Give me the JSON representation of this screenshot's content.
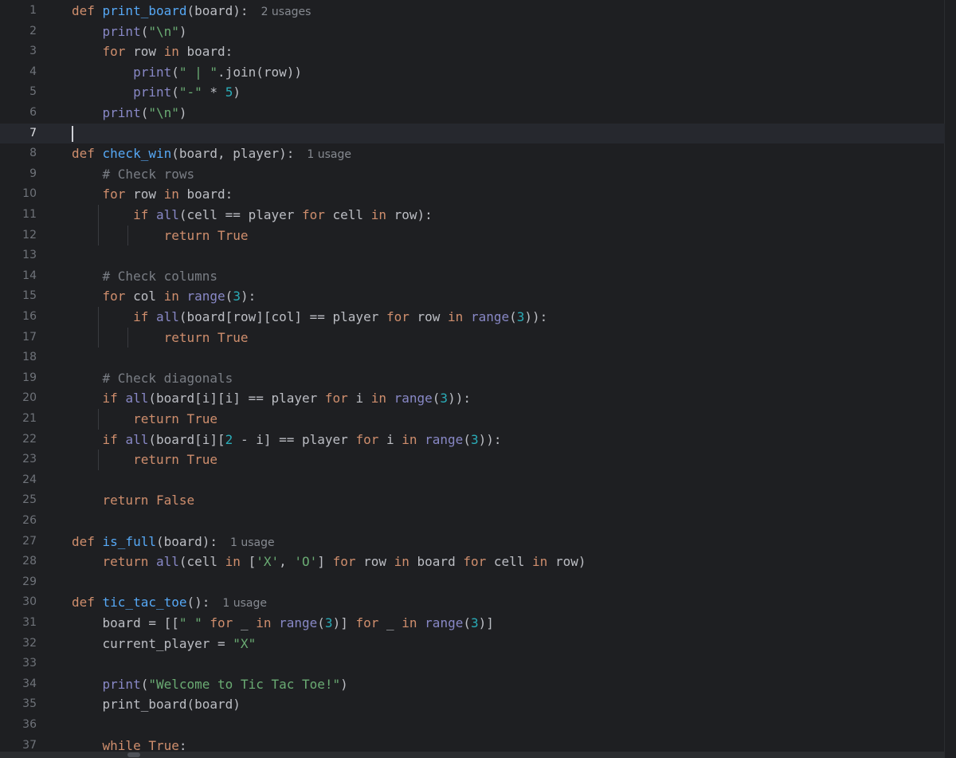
{
  "editor": {
    "current_line": 7,
    "lines": [
      {
        "n": "1",
        "tokens": [
          [
            "kw",
            "def "
          ],
          [
            "fn",
            "print_board"
          ],
          [
            "",
            "(board):"
          ]
        ],
        "hint": "2 usages"
      },
      {
        "n": "2",
        "tokens": [
          [
            "",
            "    "
          ],
          [
            "bi",
            "print"
          ],
          [
            "",
            "("
          ],
          [
            "st",
            "\"\\n\""
          ],
          [
            "",
            ")"
          ]
        ]
      },
      {
        "n": "3",
        "tokens": [
          [
            "",
            "    "
          ],
          [
            "kw",
            "for "
          ],
          [
            "",
            "row "
          ],
          [
            "kw",
            "in "
          ],
          [
            "",
            "board:"
          ]
        ]
      },
      {
        "n": "4",
        "tokens": [
          [
            "",
            "        "
          ],
          [
            "bi",
            "print"
          ],
          [
            "",
            "("
          ],
          [
            "st",
            "\" | \""
          ],
          [
            "",
            ".join(row))"
          ]
        ]
      },
      {
        "n": "5",
        "tokens": [
          [
            "",
            "        "
          ],
          [
            "bi",
            "print"
          ],
          [
            "",
            "("
          ],
          [
            "st",
            "\"-\""
          ],
          [
            "",
            " * "
          ],
          [
            "nm",
            "5"
          ],
          [
            "",
            ")"
          ]
        ]
      },
      {
        "n": "6",
        "tokens": [
          [
            "",
            "    "
          ],
          [
            "bi",
            "print"
          ],
          [
            "",
            "("
          ],
          [
            "st",
            "\"\\n\""
          ],
          [
            "",
            ")"
          ]
        ]
      },
      {
        "n": "7",
        "tokens": []
      },
      {
        "n": "8",
        "tokens": [
          [
            "kw",
            "def "
          ],
          [
            "fn",
            "check_win"
          ],
          [
            "",
            "(board, player):"
          ]
        ],
        "hint": "1 usage"
      },
      {
        "n": "9",
        "tokens": [
          [
            "",
            "    "
          ],
          [
            "cm",
            "# Check rows"
          ]
        ]
      },
      {
        "n": "10",
        "tokens": [
          [
            "",
            "    "
          ],
          [
            "kw",
            "for "
          ],
          [
            "",
            "row "
          ],
          [
            "kw",
            "in "
          ],
          [
            "",
            "board:"
          ]
        ]
      },
      {
        "n": "11",
        "tokens": [
          [
            "",
            "        "
          ],
          [
            "kw",
            "if "
          ],
          [
            "bi",
            "all"
          ],
          [
            "",
            "(cell == player "
          ],
          [
            "kw",
            "for "
          ],
          [
            "",
            "cell "
          ],
          [
            "kw",
            "in "
          ],
          [
            "",
            "row):"
          ]
        ]
      },
      {
        "n": "12",
        "tokens": [
          [
            "",
            "            "
          ],
          [
            "kw",
            "return True"
          ]
        ]
      },
      {
        "n": "13",
        "tokens": []
      },
      {
        "n": "14",
        "tokens": [
          [
            "",
            "    "
          ],
          [
            "cm",
            "# Check columns"
          ]
        ]
      },
      {
        "n": "15",
        "tokens": [
          [
            "",
            "    "
          ],
          [
            "kw",
            "for "
          ],
          [
            "",
            "col "
          ],
          [
            "kw",
            "in "
          ],
          [
            "bi",
            "range"
          ],
          [
            "",
            "("
          ],
          [
            "nm",
            "3"
          ],
          [
            "",
            "):"
          ]
        ]
      },
      {
        "n": "16",
        "tokens": [
          [
            "",
            "        "
          ],
          [
            "kw",
            "if "
          ],
          [
            "bi",
            "all"
          ],
          [
            "",
            "(board[row][col] == player "
          ],
          [
            "kw",
            "for "
          ],
          [
            "",
            "row "
          ],
          [
            "kw",
            "in "
          ],
          [
            "bi",
            "range"
          ],
          [
            "",
            "("
          ],
          [
            "nm",
            "3"
          ],
          [
            "",
            "))"
          ],
          [
            "",
            ":"
          ]
        ]
      },
      {
        "n": "17",
        "tokens": [
          [
            "",
            "            "
          ],
          [
            "kw",
            "return True"
          ]
        ]
      },
      {
        "n": "18",
        "tokens": []
      },
      {
        "n": "19",
        "tokens": [
          [
            "",
            "    "
          ],
          [
            "cm",
            "# Check diagonals"
          ]
        ]
      },
      {
        "n": "20",
        "tokens": [
          [
            "",
            "    "
          ],
          [
            "kw",
            "if "
          ],
          [
            "bi",
            "all"
          ],
          [
            "",
            "(board[i][i] == player "
          ],
          [
            "kw",
            "for "
          ],
          [
            "",
            "i "
          ],
          [
            "kw",
            "in "
          ],
          [
            "bi",
            "range"
          ],
          [
            "",
            "("
          ],
          [
            "nm",
            "3"
          ],
          [
            "",
            ")):"
          ]
        ]
      },
      {
        "n": "21",
        "tokens": [
          [
            "",
            "        "
          ],
          [
            "kw",
            "return True"
          ]
        ]
      },
      {
        "n": "22",
        "tokens": [
          [
            "",
            "    "
          ],
          [
            "kw",
            "if "
          ],
          [
            "bi",
            "all"
          ],
          [
            "",
            "(board[i]["
          ],
          [
            "nm",
            "2"
          ],
          [
            "",
            " - i] == player "
          ],
          [
            "kw",
            "for "
          ],
          [
            "",
            "i "
          ],
          [
            "kw",
            "in "
          ],
          [
            "bi",
            "range"
          ],
          [
            "",
            "("
          ],
          [
            "nm",
            "3"
          ],
          [
            "",
            ")):"
          ]
        ]
      },
      {
        "n": "23",
        "tokens": [
          [
            "",
            "        "
          ],
          [
            "kw",
            "return True"
          ]
        ]
      },
      {
        "n": "24",
        "tokens": []
      },
      {
        "n": "25",
        "tokens": [
          [
            "",
            "    "
          ],
          [
            "kw",
            "return False"
          ]
        ]
      },
      {
        "n": "26",
        "tokens": []
      },
      {
        "n": "27",
        "tokens": [
          [
            "kw",
            "def "
          ],
          [
            "fn",
            "is_full"
          ],
          [
            "",
            "(board):"
          ]
        ],
        "hint": "1 usage"
      },
      {
        "n": "28",
        "tokens": [
          [
            "",
            "    "
          ],
          [
            "kw",
            "return "
          ],
          [
            "bi",
            "all"
          ],
          [
            "",
            "(cell "
          ],
          [
            "kw",
            "in "
          ],
          [
            "",
            "["
          ],
          [
            "st",
            "'X'"
          ],
          [
            "",
            ", "
          ],
          [
            "st",
            "'O'"
          ],
          [
            "",
            "] "
          ],
          [
            "kw",
            "for "
          ],
          [
            "",
            "row "
          ],
          [
            "kw",
            "in "
          ],
          [
            "",
            "board "
          ],
          [
            "kw",
            "for "
          ],
          [
            "",
            "cell "
          ],
          [
            "kw",
            "in "
          ],
          [
            "",
            "row)"
          ]
        ]
      },
      {
        "n": "29",
        "tokens": []
      },
      {
        "n": "30",
        "tokens": [
          [
            "kw",
            "def "
          ],
          [
            "fn",
            "tic_tac_toe"
          ],
          [
            "",
            "():"
          ]
        ],
        "hint": "1 usage"
      },
      {
        "n": "31",
        "tokens": [
          [
            "",
            "    board = [["
          ],
          [
            "st",
            "\" \""
          ],
          [
            "kw",
            " for "
          ],
          [
            "",
            "_ "
          ],
          [
            "kw",
            "in "
          ],
          [
            "bi",
            "range"
          ],
          [
            "",
            "("
          ],
          [
            "nm",
            "3"
          ],
          [
            "",
            ")] "
          ],
          [
            "kw",
            "for "
          ],
          [
            "",
            "_ "
          ],
          [
            "kw",
            "in "
          ],
          [
            "bi",
            "range"
          ],
          [
            "",
            "("
          ],
          [
            "nm",
            "3"
          ],
          [
            "",
            ")]"
          ]
        ]
      },
      {
        "n": "32",
        "tokens": [
          [
            "",
            "    current_player = "
          ],
          [
            "st",
            "\"X\""
          ]
        ]
      },
      {
        "n": "33",
        "tokens": []
      },
      {
        "n": "34",
        "tokens": [
          [
            "",
            "    "
          ],
          [
            "bi",
            "print"
          ],
          [
            "",
            "("
          ],
          [
            "st",
            "\"Welcome to Tic Tac Toe!\""
          ],
          [
            "",
            ")"
          ]
        ]
      },
      {
        "n": "35",
        "tokens": [
          [
            "",
            "    print_board(board)"
          ]
        ]
      },
      {
        "n": "36",
        "tokens": []
      },
      {
        "n": "37",
        "tokens": [
          [
            "",
            "    "
          ],
          [
            "kw",
            "while True"
          ],
          [
            "",
            ":"
          ]
        ]
      }
    ]
  },
  "colors": {
    "background": "#1e1f22",
    "keyword": "#cf8e6d",
    "function": "#56a8f5",
    "builtin": "#8888c6",
    "string": "#6aab73",
    "number": "#2aacb8",
    "comment": "#7a7e85"
  }
}
